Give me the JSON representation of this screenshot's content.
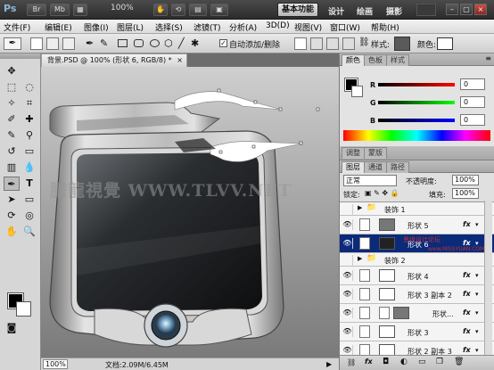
{
  "app": {
    "logo": "Ps",
    "zoom": "100%",
    "workspace": "基本功能",
    "workspace_links": [
      "设计",
      "绘画",
      "摄影"
    ]
  },
  "menu": [
    "文件(F)",
    "编辑(E)",
    "图像(I)",
    "图层(L)",
    "选择(S)",
    "滤镜(T)",
    "分析(A)",
    "3D(D)",
    "视图(V)",
    "窗口(W)",
    "帮助(H)"
  ],
  "options": {
    "auto_add_delete_label": "自动添加/删除",
    "auto_add_delete_checked": "✓",
    "style_label": "样式:",
    "color_label": "颜色:"
  },
  "document": {
    "tab_title": "背景.PSD @ 100% (形状 6, RGB/8) *",
    "tab_close": "×",
    "zoom": "100%",
    "doc_size": "文档:2.09M/6.45M",
    "watermark": "騰龍視覺 WWW.TLVV.NET"
  },
  "color_panel": {
    "tabs": [
      "颜色",
      "色板",
      "样式"
    ],
    "r_label": "R",
    "g_label": "G",
    "b_label": "B",
    "r_value": "0",
    "g_value": "0",
    "b_value": "0"
  },
  "adjust_tabs": [
    "调整",
    "蒙版"
  ],
  "layers_panel": {
    "tabs": [
      "图层",
      "通道",
      "路径"
    ],
    "blend_mode": "正常",
    "opacity_label": "不透明度:",
    "opacity_value": "100%",
    "lock_label": "锁定:",
    "fill_label": "填充:",
    "fill_value": "100%",
    "fx": "fx",
    "layers": [
      {
        "name": "装饰 1",
        "type": "group",
        "visible": false
      },
      {
        "name": "形状 5",
        "type": "shape",
        "visible": true,
        "fx": true
      },
      {
        "name": "形状 6",
        "type": "shape",
        "visible": true,
        "fx": true,
        "selected": true
      },
      {
        "name": "装饰 2",
        "type": "group",
        "visible": false
      },
      {
        "name": "形状 4",
        "type": "shape",
        "visible": true,
        "fx": true
      },
      {
        "name": "形状 3 副本 2",
        "type": "shape",
        "visible": true,
        "fx": true
      },
      {
        "name": "形状...",
        "type": "shape",
        "visible": true,
        "fx": true
      },
      {
        "name": "形状 3",
        "type": "shape",
        "visible": true,
        "fx": true
      },
      {
        "name": "形状 2 副本 3",
        "type": "shape",
        "visible": true,
        "fx": true
      }
    ]
  },
  "side_watermark": {
    "line1": "思缘设计论坛",
    "line2": "www.MISSYUAN.COM"
  },
  "colors": {
    "selected_layer": "#0b2a7a",
    "workspace_bg": "#2c2c2c"
  }
}
